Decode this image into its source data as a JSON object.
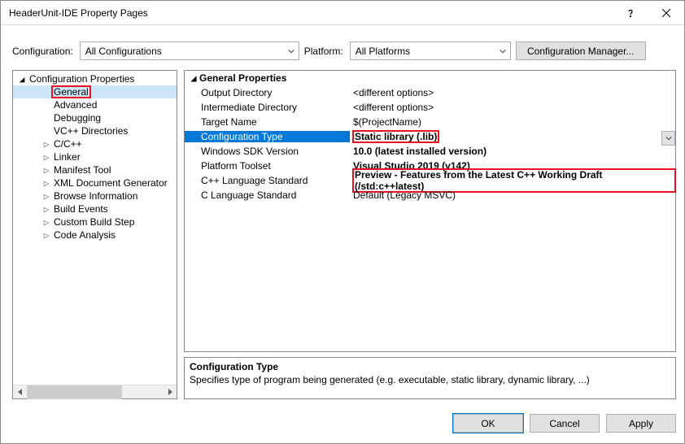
{
  "window": {
    "title": "HeaderUnit-IDE Property Pages"
  },
  "config_row": {
    "config_label": "Configuration:",
    "config_value": "All Configurations",
    "platform_label": "Platform:",
    "platform_value": "All Platforms",
    "cfg_mgr": "Configuration Manager..."
  },
  "tree": {
    "root": "Configuration Properties",
    "items": [
      {
        "label": "General",
        "expander": "",
        "selected": true,
        "hl": true
      },
      {
        "label": "Advanced",
        "expander": ""
      },
      {
        "label": "Debugging",
        "expander": ""
      },
      {
        "label": "VC++ Directories",
        "expander": ""
      },
      {
        "label": "C/C++",
        "expander": "▷"
      },
      {
        "label": "Linker",
        "expander": "▷"
      },
      {
        "label": "Manifest Tool",
        "expander": "▷"
      },
      {
        "label": "XML Document Generator",
        "expander": "▷"
      },
      {
        "label": "Browse Information",
        "expander": "▷"
      },
      {
        "label": "Build Events",
        "expander": "▷"
      },
      {
        "label": "Custom Build Step",
        "expander": "▷"
      },
      {
        "label": "Code Analysis",
        "expander": "▷"
      }
    ]
  },
  "grid": {
    "header": "General Properties",
    "rows": [
      {
        "name": "Output Directory",
        "value": "<different options>",
        "bold": false
      },
      {
        "name": "Intermediate Directory",
        "value": "<different options>",
        "bold": false
      },
      {
        "name": "Target Name",
        "value": "$(ProjectName)",
        "bold": false
      },
      {
        "name": "Configuration Type",
        "value": "Static library (.lib)",
        "bold": true,
        "selected": true,
        "hl": true,
        "dropdown": true
      },
      {
        "name": "Windows SDK Version",
        "value": "10.0 (latest installed version)",
        "bold": true
      },
      {
        "name": "Platform Toolset",
        "value": "Visual Studio 2019 (v142)",
        "bold": true
      },
      {
        "name": "C++ Language Standard",
        "value": "Preview - Features from the Latest C++ Working Draft (/std:c++latest)",
        "bold": true,
        "hl": true
      },
      {
        "name": "C Language Standard",
        "value": "Default (Legacy MSVC)",
        "bold": false
      }
    ]
  },
  "description": {
    "title": "Configuration Type",
    "body": "Specifies type of program being generated (e.g. executable, static library, dynamic library, ...)"
  },
  "footer": {
    "ok": "OK",
    "cancel": "Cancel",
    "apply": "Apply"
  }
}
